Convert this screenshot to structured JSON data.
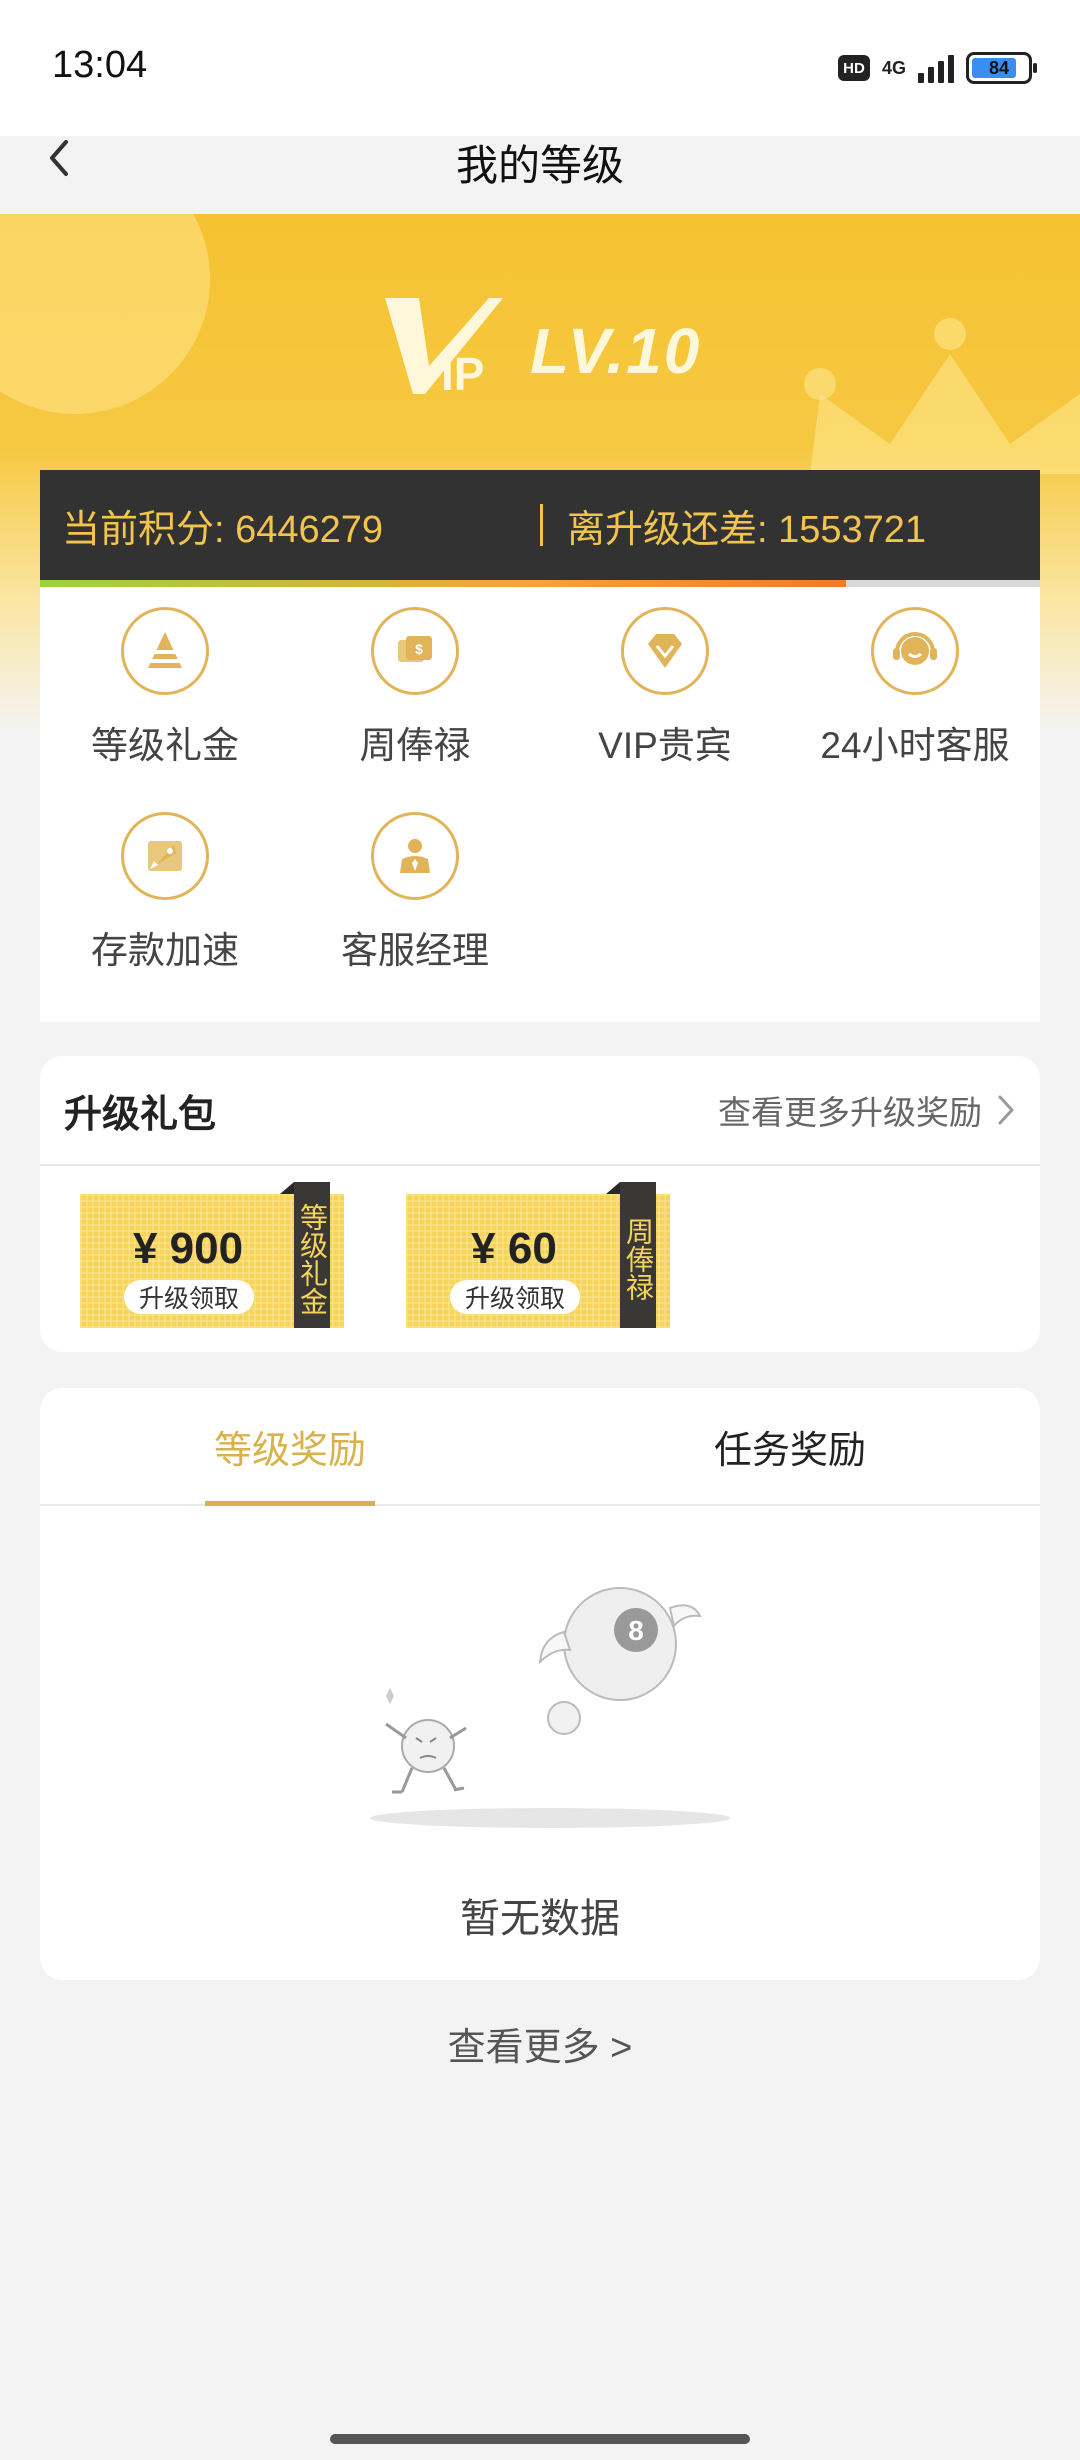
{
  "status_bar": {
    "time": "13:04",
    "hd": "HD",
    "network": "4G",
    "battery": "84"
  },
  "nav": {
    "title": "我的等级",
    "back_icon": "chevron-left-icon"
  },
  "vip": {
    "badge": "VIP",
    "level": "LV.10"
  },
  "points": {
    "current": "当前积分: 6446279",
    "remaining": "离升级还差: 1553721",
    "progress_fraction": 0.806
  },
  "privileges": [
    {
      "label": "等级礼金",
      "icon": "pyramid-icon"
    },
    {
      "label": "周俸禄",
      "icon": "dollar-card-icon"
    },
    {
      "label": "VIP贵宾",
      "icon": "diamond-icon"
    },
    {
      "label": "24小时客服",
      "icon": "headset-icon"
    },
    {
      "label": "存款加速",
      "icon": "rocket-icon"
    },
    {
      "label": "客服经理",
      "icon": "manager-icon"
    }
  ],
  "upgrade": {
    "title": "升级礼包",
    "more": "查看更多升级奖励",
    "gifts": [
      {
        "amount": "¥ 900",
        "claim": "升级领取",
        "tag": "等级礼金"
      },
      {
        "amount": "¥ 60",
        "claim": "升级领取",
        "tag": "周俸禄"
      }
    ]
  },
  "rewards": {
    "tabs": [
      "等级奖励",
      "任务奖励"
    ],
    "empty_text": "暂无数据"
  },
  "view_more": "查看更多 >",
  "colors": {
    "accent_gold": "#d9b24c",
    "banner_yellow": "#f5c231",
    "points_bar": "#333232"
  }
}
